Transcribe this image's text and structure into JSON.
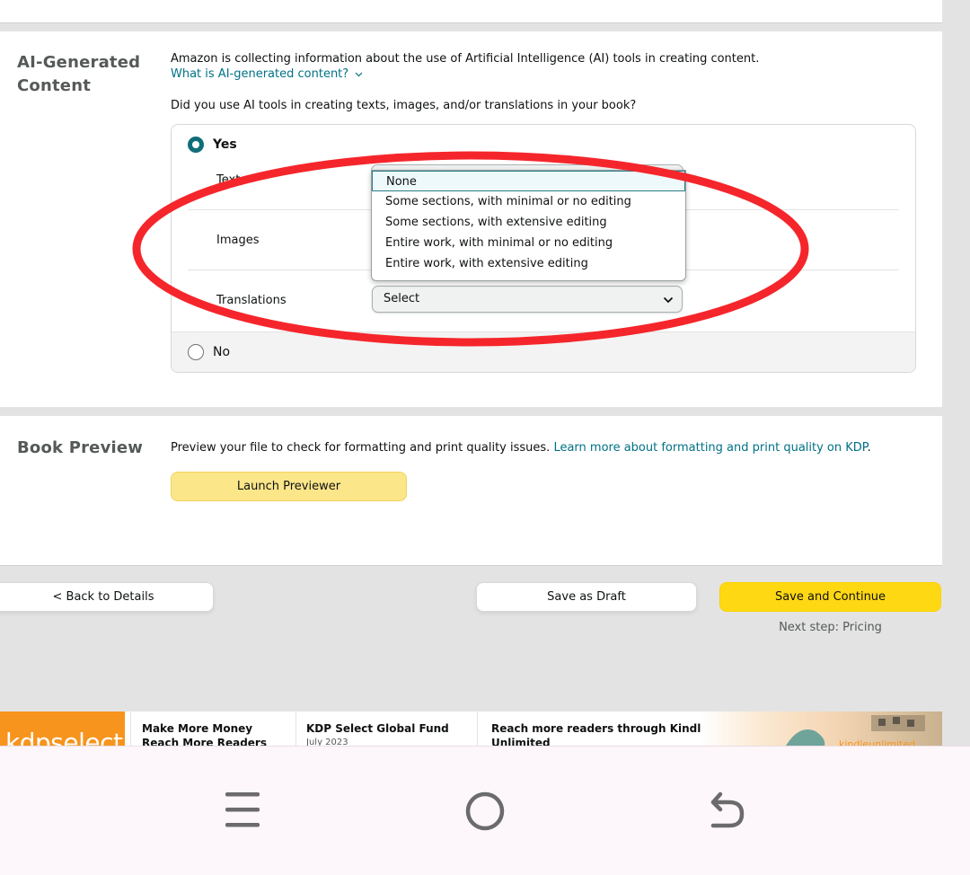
{
  "ai_section": {
    "title_line1": "AI-Generated",
    "title_line2": "Content",
    "intro": "Amazon is collecting information about the use of Artificial Intelligence (AI) tools in creating content.",
    "what_link": "What is AI-generated content?",
    "question": "Did you use AI tools in creating texts, images, and/or translations in your book?",
    "yes_label": "Yes",
    "no_label": "No",
    "texts_label": "Texts",
    "images_label": "Images",
    "translations_label": "Translations",
    "translations_select": "Select",
    "dropdown_options": [
      "None",
      "Some sections, with minimal or no editing",
      "Some sections, with extensive editing",
      "Entire work, with minimal or no editing",
      "Entire work, with extensive editing"
    ],
    "selected_option": "None"
  },
  "preview_section": {
    "title": "Book Preview",
    "text": "Preview your file to check for formatting and print quality issues.",
    "link": "Learn more about formatting and print quality on KDP",
    "period": ".",
    "button": "Launch Previewer"
  },
  "footer_actions": {
    "back": "< Back to Details",
    "draft": "Save as Draft",
    "continue": "Save and Continue",
    "next_step": "Next step: Pricing"
  },
  "banner": {
    "logo": "kdpselect",
    "item1_line1": "Make More Money",
    "item1_line2": "Reach More Readers",
    "item2_title": "KDP Select Global Fund",
    "item2_sub": "July 2023",
    "item3_line1": "Reach more readers through Kindle",
    "item3_line2": "Unlimited",
    "brand_right": "kindleunlimited"
  },
  "colors": {
    "accent_teal": "#007185",
    "primary_yellow": "#ffd814",
    "annotation_red": "#f5262b"
  },
  "nav": {
    "menu_icon": "recents-icon",
    "home_icon": "home-circle-icon",
    "back_icon": "back-arrow-icon"
  }
}
